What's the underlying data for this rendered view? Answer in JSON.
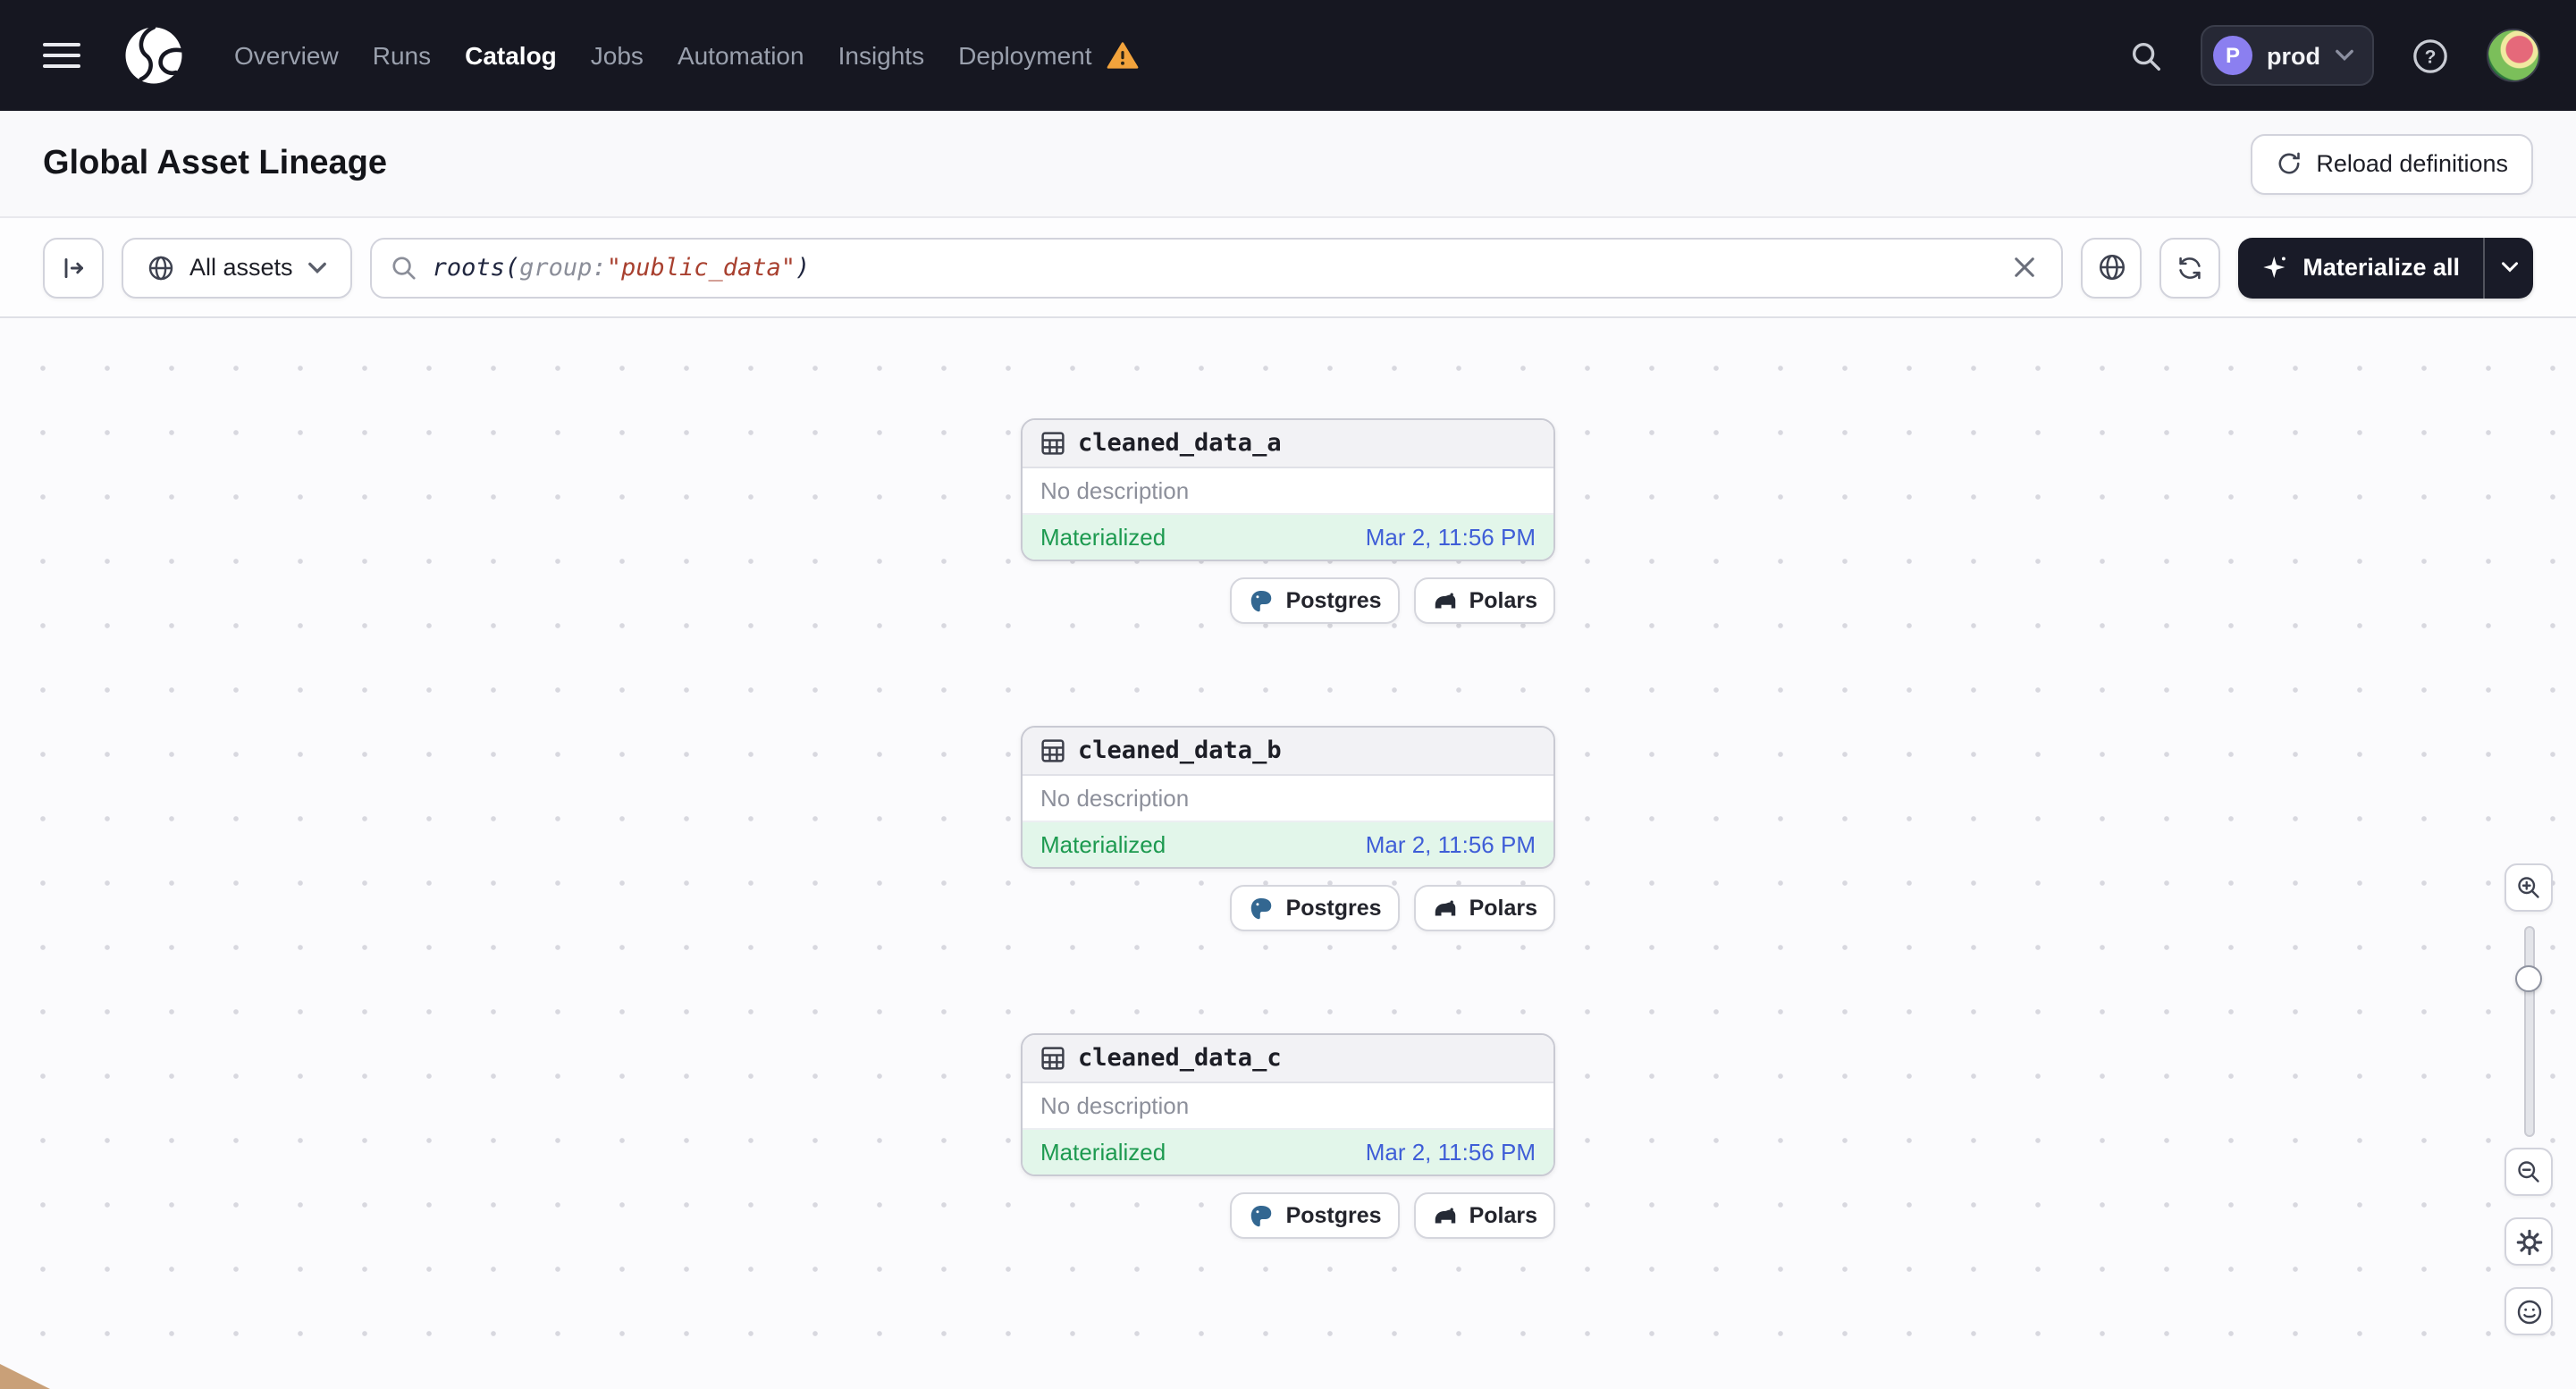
{
  "navbar": {
    "links": [
      {
        "label": "Overview",
        "active": false
      },
      {
        "label": "Runs",
        "active": false
      },
      {
        "label": "Catalog",
        "active": true
      },
      {
        "label": "Jobs",
        "active": false
      },
      {
        "label": "Automation",
        "active": false
      },
      {
        "label": "Insights",
        "active": false
      },
      {
        "label": "Deployment",
        "active": false,
        "warning": true
      }
    ],
    "deployment_switcher": {
      "initial": "P",
      "name": "prod"
    }
  },
  "header": {
    "title": "Global Asset Lineage",
    "reload_button_label": "Reload definitions"
  },
  "toolbar": {
    "asset_filter_label": "All assets",
    "query": {
      "function": "roots",
      "open": "(",
      "attribute": "group:",
      "string": "\"public_data\"",
      "close": ")"
    },
    "materialize_button_label": "Materialize all"
  },
  "canvas": {
    "nodes": [
      {
        "title": "cleaned_data_a",
        "description": "No description",
        "status": "Materialized",
        "materialized_at": "Mar 2, 11:56 PM",
        "tags": [
          "Postgres",
          "Polars"
        ]
      },
      {
        "title": "cleaned_data_b",
        "description": "No description",
        "status": "Materialized",
        "materialized_at": "Mar 2, 11:56 PM",
        "tags": [
          "Postgres",
          "Polars"
        ]
      },
      {
        "title": "cleaned_data_c",
        "description": "No description",
        "status": "Materialized",
        "materialized_at": "Mar 2, 11:56 PM",
        "tags": [
          "Postgres",
          "Polars"
        ]
      }
    ]
  },
  "colors": {
    "navbar_bg": "#161721",
    "materialize_bg": "#191B28",
    "status_green": "#1D9A50",
    "status_green_bg": "#E2F6EA",
    "timestamp_blue": "#3F5ED7",
    "warning_orange": "#F2A33C",
    "query_string_red": "#A8402F",
    "postgres_blue": "#336791"
  }
}
